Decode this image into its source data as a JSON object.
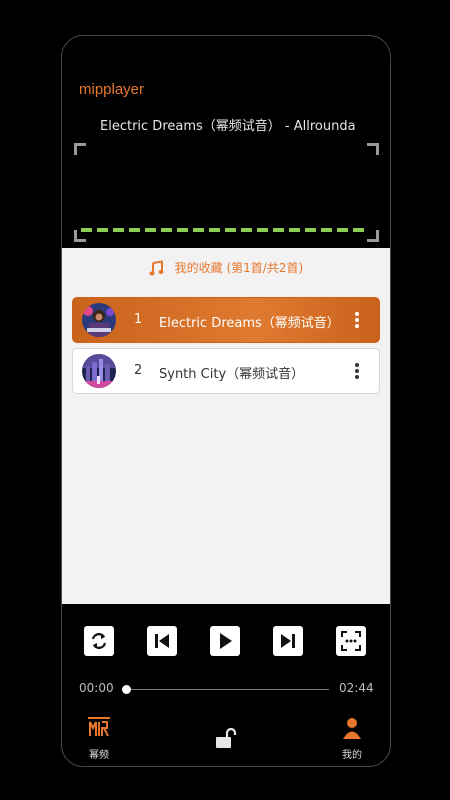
{
  "app": {
    "title": "mipplayer"
  },
  "now_playing": {
    "marquee": "Electric Dreams（幂频试音） - Allrounda"
  },
  "playlist": {
    "header": "我的收藏 (第1首/共2首)",
    "songs": [
      {
        "index": "1",
        "title": "Electric Dreams（幂频试音）",
        "active": true
      },
      {
        "index": "2",
        "title": "Synth City（幂频试音）",
        "active": false
      }
    ]
  },
  "player": {
    "current_time": "00:00",
    "total_time": "02:44",
    "progress": 0,
    "controls": [
      "repeat-icon",
      "previous-icon",
      "play-icon",
      "next-icon",
      "fullscreen-icon"
    ]
  },
  "nav": {
    "left_label": "幂频",
    "right_label": "我的",
    "center_icon": "unlock-icon"
  },
  "colors": {
    "accent": "#e8772e",
    "wave": "#8ccc57",
    "background": "#000000",
    "list_bg": "#f2f2f2"
  }
}
